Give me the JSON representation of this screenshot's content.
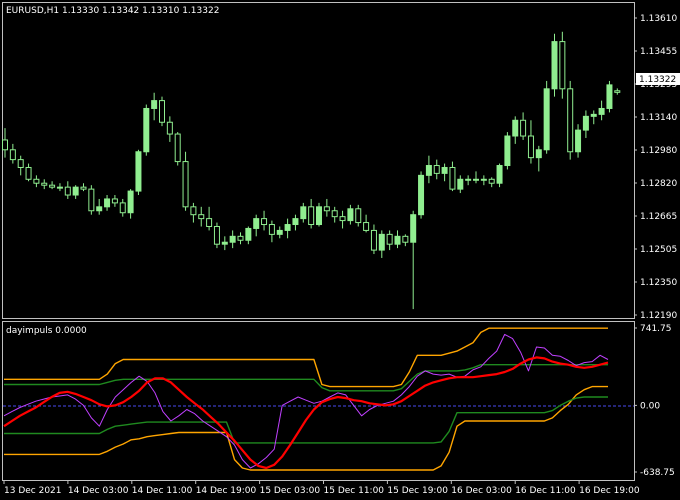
{
  "colors": {
    "background": "#000000",
    "frame": "#c0c0c0",
    "bull": "#90ee90",
    "bear": "#000000",
    "wick": "#90ee90",
    "impulse_main": "#ff0000",
    "impulse_fast": "#c040ff",
    "band_outer": "#ffa500",
    "band_inner": "#1f8a1f",
    "zero_line": "#4a4af0"
  },
  "price_chart": {
    "title": "EURUSD,H1  1.13330 1.13342 1.13310 1.13322",
    "y_ticks": [
      "1.13610",
      "1.13455",
      "1.13295",
      "1.13140",
      "1.12980",
      "1.12820",
      "1.12665",
      "1.12505",
      "1.12350",
      "1.12190"
    ],
    "current_price": "1.13322"
  },
  "indicator": {
    "title": "dayimpuls 0.0000",
    "y_ticks": [
      "741.75",
      "0.00",
      "-638.75"
    ]
  },
  "x_axis": {
    "labels": [
      "13 Dec 2021",
      "14 Dec 03:00",
      "14 Dec 11:00",
      "14 Dec 19:00",
      "15 Dec 03:00",
      "15 Dec 11:00",
      "15 Dec 19:00",
      "16 Dec 03:00",
      "16 Dec 11:00",
      "16 Dec 19:00"
    ]
  },
  "chart_data": [
    {
      "type": "candlestick",
      "title": "EURUSD,H1  1.13330 1.13342 1.13310 1.13322",
      "ylim": [
        1.1219,
        1.137
      ],
      "ohlc": [
        [
          1.1308,
          1.1314,
          1.1299,
          1.1303
        ],
        [
          1.1303,
          1.1306,
          1.1296,
          1.1298
        ],
        [
          1.1298,
          1.13,
          1.129,
          1.1294
        ],
        [
          1.1294,
          1.1296,
          1.1287,
          1.1288
        ],
        [
          1.1288,
          1.129,
          1.1284,
          1.1286
        ],
        [
          1.1286,
          1.1288,
          1.1283,
          1.1285
        ],
        [
          1.1285,
          1.1287,
          1.1283,
          1.1284
        ],
        [
          1.1284,
          1.1286,
          1.1282,
          1.1284
        ],
        [
          1.1284,
          1.1287,
          1.1278,
          1.128
        ],
        [
          1.128,
          1.1285,
          1.1278,
          1.1284
        ],
        [
          1.1284,
          1.1286,
          1.1282,
          1.1283
        ],
        [
          1.1283,
          1.1285,
          1.127,
          1.1272
        ],
        [
          1.1272,
          1.1278,
          1.127,
          1.1274
        ],
        [
          1.1274,
          1.128,
          1.1272,
          1.1278
        ],
        [
          1.1278,
          1.128,
          1.1274,
          1.1276
        ],
        [
          1.1276,
          1.1278,
          1.1269,
          1.1271
        ],
        [
          1.1271,
          1.1283,
          1.1268,
          1.1282
        ],
        [
          1.1282,
          1.1303,
          1.128,
          1.1302
        ],
        [
          1.1302,
          1.1326,
          1.13,
          1.1324
        ],
        [
          1.1324,
          1.1332,
          1.1318,
          1.1328
        ],
        [
          1.1328,
          1.133,
          1.1315,
          1.1317
        ],
        [
          1.1317,
          1.132,
          1.1307,
          1.1311
        ],
        [
          1.1311,
          1.1312,
          1.1295,
          1.1297
        ],
        [
          1.1297,
          1.1302,
          1.1272,
          1.1274
        ],
        [
          1.1274,
          1.1276,
          1.1266,
          1.127
        ],
        [
          1.127,
          1.1274,
          1.1264,
          1.1268
        ],
        [
          1.1268,
          1.1274,
          1.1262,
          1.1264
        ],
        [
          1.1264,
          1.1266,
          1.1253,
          1.1255
        ],
        [
          1.1255,
          1.1259,
          1.1252,
          1.1256
        ],
        [
          1.1256,
          1.1262,
          1.1253,
          1.1259
        ],
        [
          1.1259,
          1.1261,
          1.1255,
          1.1257
        ],
        [
          1.1257,
          1.1264,
          1.1255,
          1.1263
        ],
        [
          1.1263,
          1.127,
          1.1259,
          1.1268
        ],
        [
          1.1268,
          1.1272,
          1.1262,
          1.1265
        ],
        [
          1.1265,
          1.1267,
          1.1256,
          1.126
        ],
        [
          1.126,
          1.1264,
          1.1258,
          1.1262
        ],
        [
          1.1262,
          1.1268,
          1.1258,
          1.1265
        ],
        [
          1.1265,
          1.127,
          1.1262,
          1.1268
        ],
        [
          1.1268,
          1.1276,
          1.1266,
          1.1274
        ],
        [
          1.1274,
          1.1278,
          1.1263,
          1.1265
        ],
        [
          1.1265,
          1.1276,
          1.1264,
          1.1274
        ],
        [
          1.1274,
          1.1278,
          1.1269,
          1.1272
        ],
        [
          1.1272,
          1.1274,
          1.1266,
          1.1269
        ],
        [
          1.1269,
          1.1272,
          1.1263,
          1.1267
        ],
        [
          1.1267,
          1.1275,
          1.1265,
          1.1273
        ],
        [
          1.1273,
          1.1275,
          1.1264,
          1.1266
        ],
        [
          1.1266,
          1.127,
          1.1261,
          1.1262
        ],
        [
          1.1262,
          1.1265,
          1.125,
          1.1252
        ],
        [
          1.1252,
          1.1262,
          1.1248,
          1.126
        ],
        [
          1.126,
          1.1262,
          1.1252,
          1.1255
        ],
        [
          1.1255,
          1.1262,
          1.1253,
          1.1259
        ],
        [
          1.1259,
          1.126,
          1.1254,
          1.1256
        ],
        [
          1.1256,
          1.1272,
          1.1222,
          1.127
        ],
        [
          1.127,
          1.1292,
          1.1268,
          1.129
        ],
        [
          1.129,
          1.13,
          1.1286,
          1.1295
        ],
        [
          1.1295,
          1.1298,
          1.1288,
          1.1291
        ],
        [
          1.1291,
          1.1296,
          1.1287,
          1.1294
        ],
        [
          1.1294,
          1.1297,
          1.1282,
          1.1283
        ],
        [
          1.1283,
          1.129,
          1.1281,
          1.1288
        ],
        [
          1.1288,
          1.129,
          1.1285,
          1.1288
        ],
        [
          1.1288,
          1.1292,
          1.1286,
          1.1288
        ],
        [
          1.1288,
          1.129,
          1.1285,
          1.1288
        ],
        [
          1.1288,
          1.1289,
          1.1284,
          1.1286
        ],
        [
          1.1286,
          1.1296,
          1.1284,
          1.1295
        ],
        [
          1.1295,
          1.1312,
          1.1293,
          1.131
        ],
        [
          1.131,
          1.132,
          1.1306,
          1.1318
        ],
        [
          1.1318,
          1.1322,
          1.1308,
          1.131
        ],
        [
          1.131,
          1.1318,
          1.1296,
          1.1299
        ],
        [
          1.1299,
          1.1305,
          1.1292,
          1.1303
        ],
        [
          1.1303,
          1.1338,
          1.1301,
          1.1334
        ],
        [
          1.1334,
          1.1362,
          1.133,
          1.1358
        ],
        [
          1.1358,
          1.1363,
          1.1329,
          1.1334
        ],
        [
          1.1334,
          1.1338,
          1.1298,
          1.1302
        ],
        [
          1.1302,
          1.1316,
          1.1299,
          1.1313
        ],
        [
          1.1313,
          1.1323,
          1.1309,
          1.132
        ],
        [
          1.132,
          1.1323,
          1.1316,
          1.1321
        ],
        [
          1.1321,
          1.1328,
          1.1318,
          1.1324
        ],
        [
          1.1324,
          1.1338,
          1.1322,
          1.1336
        ],
        [
          1.1333,
          1.13342,
          1.1331,
          1.13322
        ]
      ]
    },
    {
      "type": "line",
      "title": "dayimpuls 0.0000",
      "ylim": [
        -638.75,
        741.75
      ],
      "x_count": 77,
      "series": [
        {
          "color": "#ff0000",
          "values": [
            -200,
            -150,
            -100,
            -60,
            -20,
            30,
            80,
            120,
            130,
            110,
            80,
            50,
            10,
            -10,
            0,
            30,
            80,
            140,
            220,
            260,
            260,
            220,
            150,
            80,
            20,
            -40,
            -110,
            -180,
            -260,
            -340,
            -430,
            -520,
            -580,
            -600,
            -570,
            -490,
            -380,
            -260,
            -140,
            -40,
            30,
            60,
            80,
            70,
            50,
            40,
            20,
            10,
            0,
            10,
            40,
            90,
            140,
            190,
            220,
            240,
            260,
            270,
            270,
            270,
            280,
            290,
            300,
            320,
            350,
            400,
            440,
            460,
            450,
            420,
            400,
            390,
            370,
            360,
            370,
            390,
            410
          ]
        },
        {
          "color": "#c040ff",
          "values": [
            -100,
            -60,
            -20,
            10,
            40,
            60,
            80,
            90,
            100,
            60,
            0,
            -120,
            -200,
            -40,
            80,
            150,
            220,
            280,
            230,
            120,
            -60,
            -150,
            -100,
            -40,
            -80,
            -150,
            -200,
            -250,
            -300,
            -380,
            -520,
            -600,
            -560,
            -500,
            -420,
            0,
            40,
            80,
            50,
            20,
            40,
            80,
            120,
            100,
            0,
            -100,
            -40,
            0,
            20,
            40,
            100,
            180,
            280,
            330,
            300,
            290,
            300,
            270,
            280,
            340,
            370,
            450,
            520,
            680,
            640,
            510,
            330,
            560,
            550,
            480,
            470,
            430,
            380,
            410,
            420,
            480,
            440
          ]
        },
        {
          "color": "#ffa500",
          "values": [
            -470,
            -470,
            -470,
            -470,
            -470,
            -470,
            -470,
            -470,
            -470,
            -470,
            -470,
            -470,
            -470,
            -440,
            -400,
            -370,
            -330,
            -320,
            -300,
            -290,
            -280,
            -270,
            -260,
            -260,
            -260,
            -260,
            -260,
            -260,
            -260,
            -520,
            -600,
            -620,
            -620,
            -620,
            -620,
            -620,
            -620,
            -620,
            -620,
            -620,
            -620,
            -620,
            -620,
            -620,
            -620,
            -620,
            -620,
            -620,
            -620,
            -620,
            -620,
            -620,
            -620,
            -620,
            -620,
            -580,
            -450,
            -200,
            -150,
            -150,
            -150,
            -150,
            -150,
            -150,
            -150,
            -150,
            -150,
            -150,
            -150,
            -120,
            -50,
            10,
            100,
            150,
            180,
            180,
            180
          ]
        },
        {
          "color": "#ffa500",
          "values": [
            250,
            250,
            250,
            250,
            250,
            250,
            250,
            250,
            250,
            250,
            250,
            250,
            250,
            300,
            400,
            440,
            440,
            440,
            440,
            440,
            440,
            440,
            440,
            440,
            440,
            440,
            440,
            440,
            440,
            440,
            440,
            440,
            440,
            440,
            440,
            440,
            440,
            440,
            440,
            440,
            200,
            180,
            180,
            180,
            180,
            180,
            180,
            180,
            180,
            180,
            200,
            320,
            480,
            480,
            480,
            480,
            500,
            520,
            560,
            600,
            700,
            740,
            740,
            740,
            740,
            740,
            740,
            740,
            740,
            740,
            740,
            740,
            740,
            740,
            740,
            740,
            740
          ]
        },
        {
          "color": "#1f8a1f",
          "values": [
            -270,
            -270,
            -270,
            -270,
            -270,
            -270,
            -270,
            -270,
            -270,
            -270,
            -270,
            -270,
            -270,
            -230,
            -200,
            -190,
            -180,
            -170,
            -160,
            -160,
            -160,
            -160,
            -160,
            -160,
            -160,
            -160,
            -160,
            -160,
            -160,
            -360,
            -360,
            -360,
            -360,
            -360,
            -360,
            -360,
            -360,
            -360,
            -360,
            -360,
            -360,
            -360,
            -360,
            -360,
            -360,
            -360,
            -360,
            -360,
            -360,
            -360,
            -360,
            -360,
            -360,
            -360,
            -360,
            -350,
            -250,
            -70,
            -70,
            -70,
            -70,
            -70,
            -70,
            -70,
            -70,
            -70,
            -70,
            -70,
            -70,
            -50,
            0,
            40,
            70,
            80,
            80,
            80,
            80
          ]
        },
        {
          "color": "#1f8a1f",
          "values": [
            200,
            200,
            200,
            200,
            200,
            200,
            200,
            200,
            200,
            200,
            200,
            200,
            200,
            220,
            240,
            250,
            250,
            250,
            250,
            250,
            250,
            250,
            250,
            250,
            250,
            250,
            250,
            250,
            250,
            250,
            250,
            250,
            250,
            250,
            250,
            250,
            250,
            250,
            250,
            250,
            170,
            140,
            140,
            140,
            140,
            140,
            140,
            140,
            140,
            140,
            160,
            230,
            300,
            330,
            330,
            330,
            330,
            330,
            340,
            360,
            390,
            390,
            390,
            390,
            390,
            390,
            390,
            390,
            390,
            390,
            390,
            390,
            390,
            390,
            390,
            390,
            390
          ]
        }
      ]
    }
  ]
}
